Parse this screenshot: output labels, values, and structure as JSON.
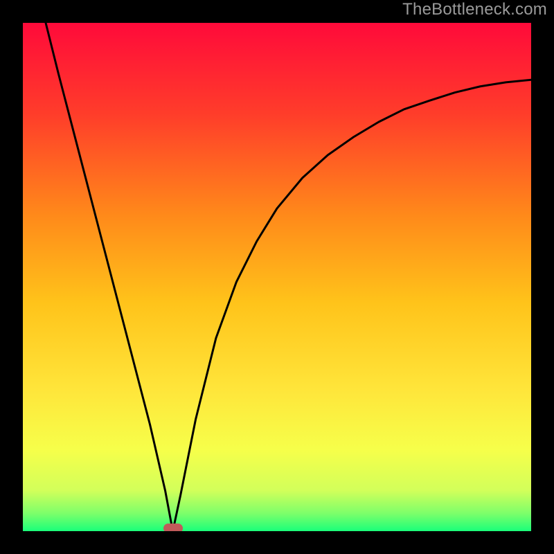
{
  "watermark": "TheBottleneck.com",
  "chart_data": {
    "type": "line",
    "title": "",
    "xlabel": "",
    "ylabel": "",
    "x_range": [
      0,
      1
    ],
    "y_range": [
      0,
      1
    ],
    "curve": {
      "name": "bottleneck-curve",
      "x": [
        0.045,
        0.07,
        0.1,
        0.13,
        0.16,
        0.19,
        0.22,
        0.25,
        0.28,
        0.295,
        0.31,
        0.34,
        0.38,
        0.42,
        0.46,
        0.5,
        0.55,
        0.6,
        0.65,
        0.7,
        0.75,
        0.8,
        0.85,
        0.9,
        0.95,
        1.0
      ],
      "y": [
        1.0,
        0.9,
        0.785,
        0.67,
        0.555,
        0.44,
        0.325,
        0.21,
        0.08,
        0.0,
        0.07,
        0.22,
        0.38,
        0.49,
        0.57,
        0.635,
        0.695,
        0.74,
        0.775,
        0.805,
        0.83,
        0.847,
        0.863,
        0.875,
        0.883,
        0.888
      ]
    },
    "minimum": {
      "x": 0.295,
      "y": 0.0
    },
    "background_gradient": {
      "type": "vertical",
      "stops": [
        {
          "pos": 0.0,
          "color": "#ff0a3a"
        },
        {
          "pos": 0.18,
          "color": "#ff3d2a"
        },
        {
          "pos": 0.38,
          "color": "#ff8a1a"
        },
        {
          "pos": 0.55,
          "color": "#ffc31a"
        },
        {
          "pos": 0.72,
          "color": "#ffe53a"
        },
        {
          "pos": 0.84,
          "color": "#f6ff4a"
        },
        {
          "pos": 0.92,
          "color": "#d2ff5a"
        },
        {
          "pos": 0.965,
          "color": "#7dff6a"
        },
        {
          "pos": 1.0,
          "color": "#1aff7a"
        }
      ]
    },
    "curve_style": {
      "stroke": "#000000",
      "stroke_width": 3
    }
  }
}
